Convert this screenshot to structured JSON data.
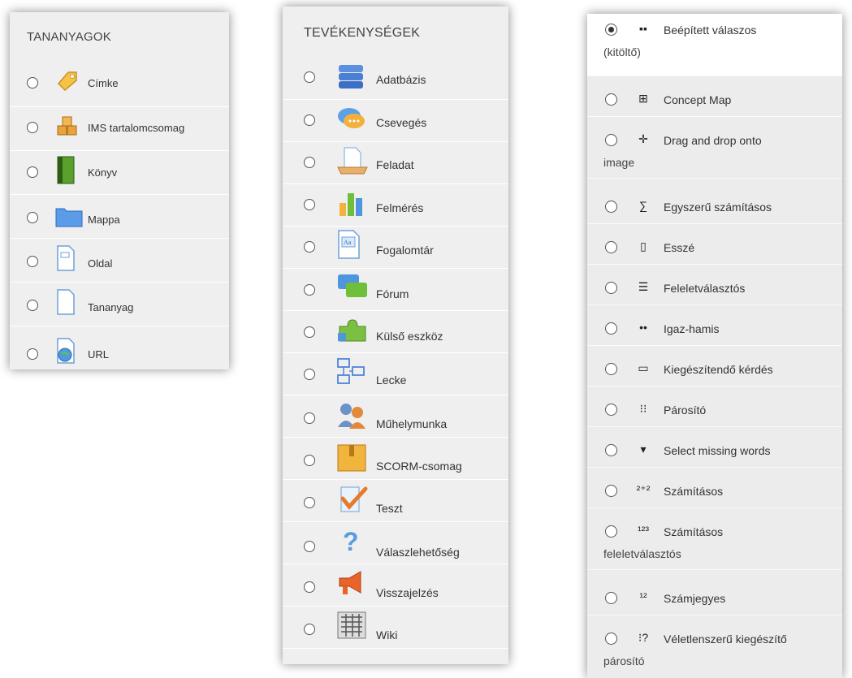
{
  "resources": {
    "header": "TANANYAGOK",
    "items": [
      {
        "label": "Címke",
        "icon": "label-tag-icon"
      },
      {
        "label": "IMS tartalomcsomag",
        "icon": "ims-package-icon"
      },
      {
        "label": "Könyv",
        "icon": "book-icon"
      },
      {
        "label": "Mappa",
        "icon": "folder-icon"
      },
      {
        "label": "Oldal",
        "icon": "page-icon"
      },
      {
        "label": "Tananyag",
        "icon": "file-icon"
      },
      {
        "label": "URL",
        "icon": "url-globe-icon"
      }
    ]
  },
  "activities": {
    "header": "TEVÉKENYSÉGEK",
    "items": [
      {
        "label": "Adatbázis",
        "icon": "database-icon"
      },
      {
        "label": "Csevegés",
        "icon": "chat-icon"
      },
      {
        "label": "Feladat",
        "icon": "assignment-icon"
      },
      {
        "label": "Felmérés",
        "icon": "survey-chart-icon"
      },
      {
        "label": "Fogalomtár",
        "icon": "glossary-icon"
      },
      {
        "label": "Fórum",
        "icon": "forum-icon"
      },
      {
        "label": "Külső eszköz",
        "icon": "puzzle-icon"
      },
      {
        "label": "Lecke",
        "icon": "lesson-icon"
      },
      {
        "label": "Műhelymunka",
        "icon": "workshop-icon"
      },
      {
        "label": "SCORM-csomag",
        "icon": "scorm-box-icon"
      },
      {
        "label": "Teszt",
        "icon": "quiz-check-icon"
      },
      {
        "label": "Válaszlehetőség",
        "icon": "question-mark-icon"
      },
      {
        "label": "Visszajelzés",
        "icon": "megaphone-icon"
      },
      {
        "label": "Wiki",
        "icon": "wiki-icon"
      }
    ]
  },
  "question_types": {
    "items": [
      {
        "line1": "Beépített válaszos",
        "line2": "(kitöltő)",
        "icon": "embedded-answers-icon",
        "glyph": "▪▪",
        "selected": true
      },
      {
        "line1": "Concept Map",
        "line2": "",
        "icon": "concept-map-icon",
        "glyph": "⊞",
        "selected": false
      },
      {
        "line1": "Drag and drop onto",
        "line2": "image",
        "icon": "drag-drop-cross-icon",
        "glyph": "✛",
        "selected": false
      },
      {
        "line1": "Egyszerű számításos",
        "line2": "",
        "icon": "simple-calculated-icon",
        "glyph": "∑",
        "selected": false
      },
      {
        "line1": "Esszé",
        "line2": "",
        "icon": "essay-icon",
        "glyph": "▯",
        "selected": false
      },
      {
        "line1": "Feleletválasztós",
        "line2": "",
        "icon": "multiple-choice-icon",
        "glyph": "☰",
        "selected": false
      },
      {
        "line1": "Igaz-hamis",
        "line2": "",
        "icon": "true-false-icon",
        "glyph": "••",
        "selected": false
      },
      {
        "line1": "Kiegészítendő kérdés",
        "line2": "",
        "icon": "short-answer-icon",
        "glyph": "▭",
        "selected": false
      },
      {
        "line1": "Párosító",
        "line2": "",
        "icon": "matching-icon",
        "glyph": "⁝⁝",
        "selected": false
      },
      {
        "line1": "Select missing words",
        "line2": "",
        "icon": "dropdown-arrow-icon",
        "glyph": "▾",
        "selected": false
      },
      {
        "line1": "Számításos",
        "line2": "",
        "icon": "calculated-icon",
        "glyph": "²⁺²",
        "selected": false
      },
      {
        "line1": "Számításos",
        "line2": "feleletválasztós",
        "icon": "calculated-multi-icon",
        "glyph": "¹²³",
        "selected": false
      },
      {
        "line1": "Számjegyes",
        "line2": "",
        "icon": "numerical-icon",
        "glyph": "¹²",
        "selected": false
      },
      {
        "line1": "Véletlenszerű kiegészítő",
        "line2": "párosító",
        "icon": "random-short-answer-matching-icon",
        "glyph": "⁝?",
        "selected": false
      }
    ]
  },
  "colors": {
    "panel_bg": "#efefef",
    "radio_border": "#555555",
    "text": "#333333",
    "selected_row_bg": "#ffffff"
  }
}
